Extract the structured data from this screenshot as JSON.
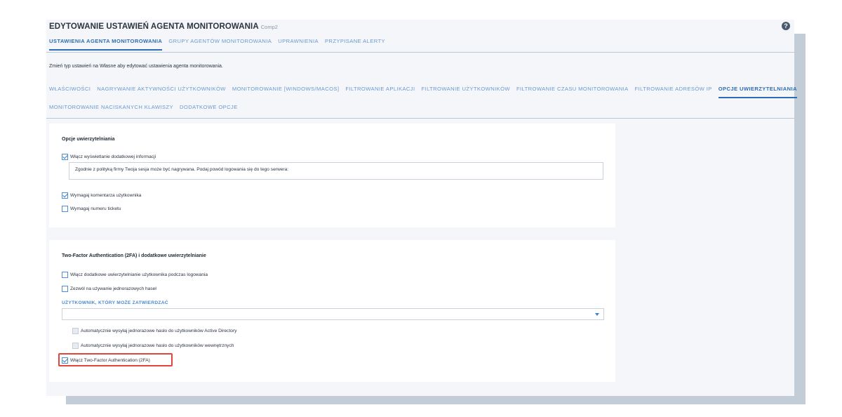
{
  "header": {
    "title": "EDYTOWANIE USTAWIEŃ AGENTA MONITOROWANIA",
    "subtitle": "Comp2",
    "help_icon": "?"
  },
  "main_tabs": [
    {
      "label": "USTAWIENIA AGENTA MONITOROWANIA",
      "active": true
    },
    {
      "label": "GRUPY AGENTÓW MONITOROWANIA",
      "active": false
    },
    {
      "label": "UPRAWNIENIA",
      "active": false
    },
    {
      "label": "PRZYPISANE ALERTY",
      "active": false
    }
  ],
  "info_text": "Zmień typ ustawień na Własne aby edytować ustawienia agenta monitorowania.",
  "sub_tabs": [
    {
      "label": "WŁAŚCIWOŚCI",
      "active": false
    },
    {
      "label": "NAGRYWANIE AKTYWNOŚCI UŻYTKOWNIKÓW",
      "active": false
    },
    {
      "label": "MONITOROWANIE [WINDOWS/MACOS]",
      "active": false
    },
    {
      "label": "FILTROWANIE APLIKACJI",
      "active": false
    },
    {
      "label": "FILTROWANIE UŻYTKOWNIKÓW",
      "active": false
    },
    {
      "label": "FILTROWANIE CZASU MONITOROWANIA",
      "active": false
    },
    {
      "label": "FILTROWANIE ADRESÓW IP",
      "active": false
    },
    {
      "label": "OPCJE UWIERZYTELNIANIA",
      "active": true
    },
    {
      "label": "MONITOROWANIE NACISKANYCH KLAWISZY",
      "active": false
    },
    {
      "label": "DODATKOWE OPCJE",
      "active": false
    }
  ],
  "auth_options": {
    "title": "Opcje uwierzytelniania",
    "show_info": {
      "label": "Włącz wyświetlanie dodatkowej informacji",
      "checked": true
    },
    "info_field_value": "Zgodnie z polityką firmy Twoja sesja może być nagrywana. Podaj powód logowania się do tego serwera:",
    "require_comment": {
      "label": "Wymagaj komentarza użytkownika",
      "checked": true
    },
    "require_ticket": {
      "label": "Wymagaj numeru ticketu",
      "checked": false
    }
  },
  "twofa": {
    "title": "Two-Factor Authentication (2FA) i dodatkowe uwierzytelnianie",
    "extra_auth": {
      "label": "Włącz dodatkowe uwierzytelnianie użytkownika podczas logowania",
      "checked": false
    },
    "one_time_pw": {
      "label": "Zezwól na używanie jednorazowych haseł",
      "checked": false
    },
    "approver_label": "UŻYTKOWNIK, KTÓRY MOŻE ZATWIERDZAĆ",
    "approver_value": "",
    "auto_ad": {
      "label": "Automatycznie wysyłaj jednorazowe hasło do użytkowników Active Directory",
      "checked": false,
      "disabled": true
    },
    "auto_internal": {
      "label": "Automatycznie wysyłaj jednorazowe hasło do użytkowników wewnętrznych",
      "checked": false,
      "disabled": true
    },
    "enable_2fa": {
      "label": "Włącz Two-Factor Authentication (2FA)",
      "checked": true
    }
  },
  "colors": {
    "accent": "#2e6cb5",
    "highlight": "#e0463a"
  }
}
